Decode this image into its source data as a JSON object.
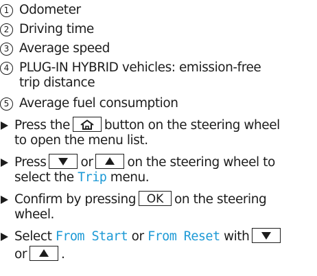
{
  "legend": [
    {
      "number": "1",
      "text": "Odometer"
    },
    {
      "number": "2",
      "text": "Driving time"
    },
    {
      "number": "3",
      "text": "Average speed"
    },
    {
      "number": "4",
      "text_line1": "PLUG-IN HYBRID vehicles: emission-free",
      "text_line2": "trip distance"
    },
    {
      "number": "5",
      "text": "Average fuel consumption"
    }
  ],
  "steps": {
    "step1": {
      "before": "Press the",
      "after": "button on the steering wheel",
      "line2": "to open the menu list."
    },
    "step2": {
      "press": "Press",
      "or": "or",
      "after": "on the steering wheel to",
      "line2_before": "select the",
      "menu": "Trip",
      "line2_after": "menu."
    },
    "step3": {
      "before": "Confirm by pressing",
      "key": "OK",
      "after": "on the steering",
      "line2": "wheel."
    },
    "step4": {
      "select": "Select",
      "option1": "From Start",
      "or": "or",
      "option2": "From Reset",
      "with": "with",
      "line2_or": "or",
      "end": "."
    }
  },
  "icons": {
    "home": "home-icon",
    "down": "down-triangle-icon",
    "up": "up-triangle-icon",
    "bullet": "arrow-bullet-icon"
  },
  "colors": {
    "text": "#1c1c1c",
    "menu_highlight": "#1e9ad6"
  }
}
